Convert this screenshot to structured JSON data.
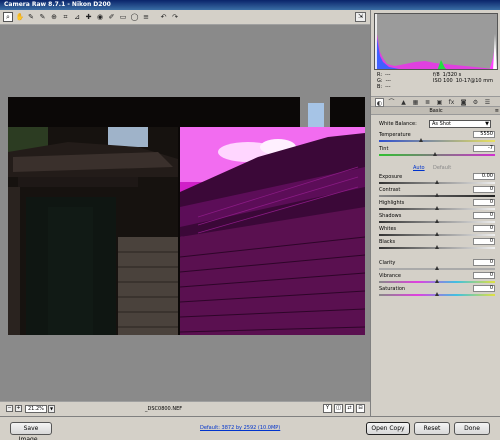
{
  "window": {
    "title": "Camera Raw 8.7.1 - Nikon D200"
  },
  "toolbar": {
    "tools": [
      {
        "name": "zoom-tool-button",
        "glyph": "⌕"
      },
      {
        "name": "hand-tool-button",
        "glyph": "✋"
      },
      {
        "name": "white-balance-tool-button",
        "glyph": "✎"
      },
      {
        "name": "color-sampler-tool-button",
        "glyph": "✎"
      },
      {
        "name": "targeted-adjustment-tool-button",
        "glyph": "⊕"
      },
      {
        "name": "crop-tool-button",
        "glyph": "⌗"
      },
      {
        "name": "straighten-tool-button",
        "glyph": "⊿"
      },
      {
        "name": "spot-removal-tool-button",
        "glyph": "✚"
      },
      {
        "name": "red-eye-tool-button",
        "glyph": "◉"
      },
      {
        "name": "adjustment-brush-button",
        "glyph": "✐"
      },
      {
        "name": "graduated-filter-button",
        "glyph": "▭"
      },
      {
        "name": "radial-filter-button",
        "glyph": "◯"
      },
      {
        "name": "preferences-button",
        "glyph": "≡"
      },
      {
        "name": "rotate-ccw-button",
        "glyph": "↶"
      },
      {
        "name": "rotate-cw-button",
        "glyph": "↷"
      }
    ],
    "preview_glyph": "⇲"
  },
  "readout": {
    "r_label": "R:",
    "g_label": "G:",
    "b_label": "B:",
    "r_value": "---",
    "g_value": "---",
    "b_value": "---",
    "aperture": "f/8",
    "shutter": "1/320 s",
    "iso": "ISO 100",
    "lens": "10-17@10 mm"
  },
  "panel_icons": [
    "◐",
    "⌒",
    "▲",
    "▦",
    "≣",
    "▣",
    "fx",
    "◙",
    "⚙",
    "☰"
  ],
  "basic": {
    "section_title": "Basic",
    "menu_glyph": "≡",
    "white_balance_label": "White Balance:",
    "white_balance_value": "As Shot",
    "auto_label": "Auto",
    "default_label": "Default",
    "temperature": {
      "label": "Temperature",
      "value": "5550",
      "pos": 0.36
    },
    "tint": {
      "label": "Tint",
      "value": "-7",
      "pos": 0.48
    },
    "sliders": [
      {
        "label": "Exposure",
        "value": "0.00",
        "pos": 0.5
      },
      {
        "label": "Contrast",
        "value": "0",
        "pos": 0.5
      },
      {
        "label": "Highlights",
        "value": "0",
        "pos": 0.5
      },
      {
        "label": "Shadows",
        "value": "0",
        "pos": 0.5
      },
      {
        "label": "Whites",
        "value": "0",
        "pos": 0.5
      },
      {
        "label": "Blacks",
        "value": "0",
        "pos": 0.5
      },
      {
        "label": "Clarity",
        "value": "0",
        "pos": 0.5
      },
      {
        "label": "Vibrance",
        "value": "0",
        "pos": 0.5
      },
      {
        "label": "Saturation",
        "value": "0",
        "pos": 0.5
      }
    ]
  },
  "status": {
    "zoom_value": "21.2%",
    "zoom_out_glyph": "−",
    "zoom_in_glyph": "+",
    "zoom_arrow_glyph": "▼",
    "filename": "_DSC0800.NEF",
    "view_glyphs": [
      "Y",
      "◫",
      "⇄",
      "⊟"
    ]
  },
  "bottom": {
    "save_label": "Save Image...",
    "workflow_label": "Default: 3872 by 2592 (10.0MP)",
    "open_label": "Open Copy",
    "reset_label": "Reset",
    "done_label": "Done"
  }
}
